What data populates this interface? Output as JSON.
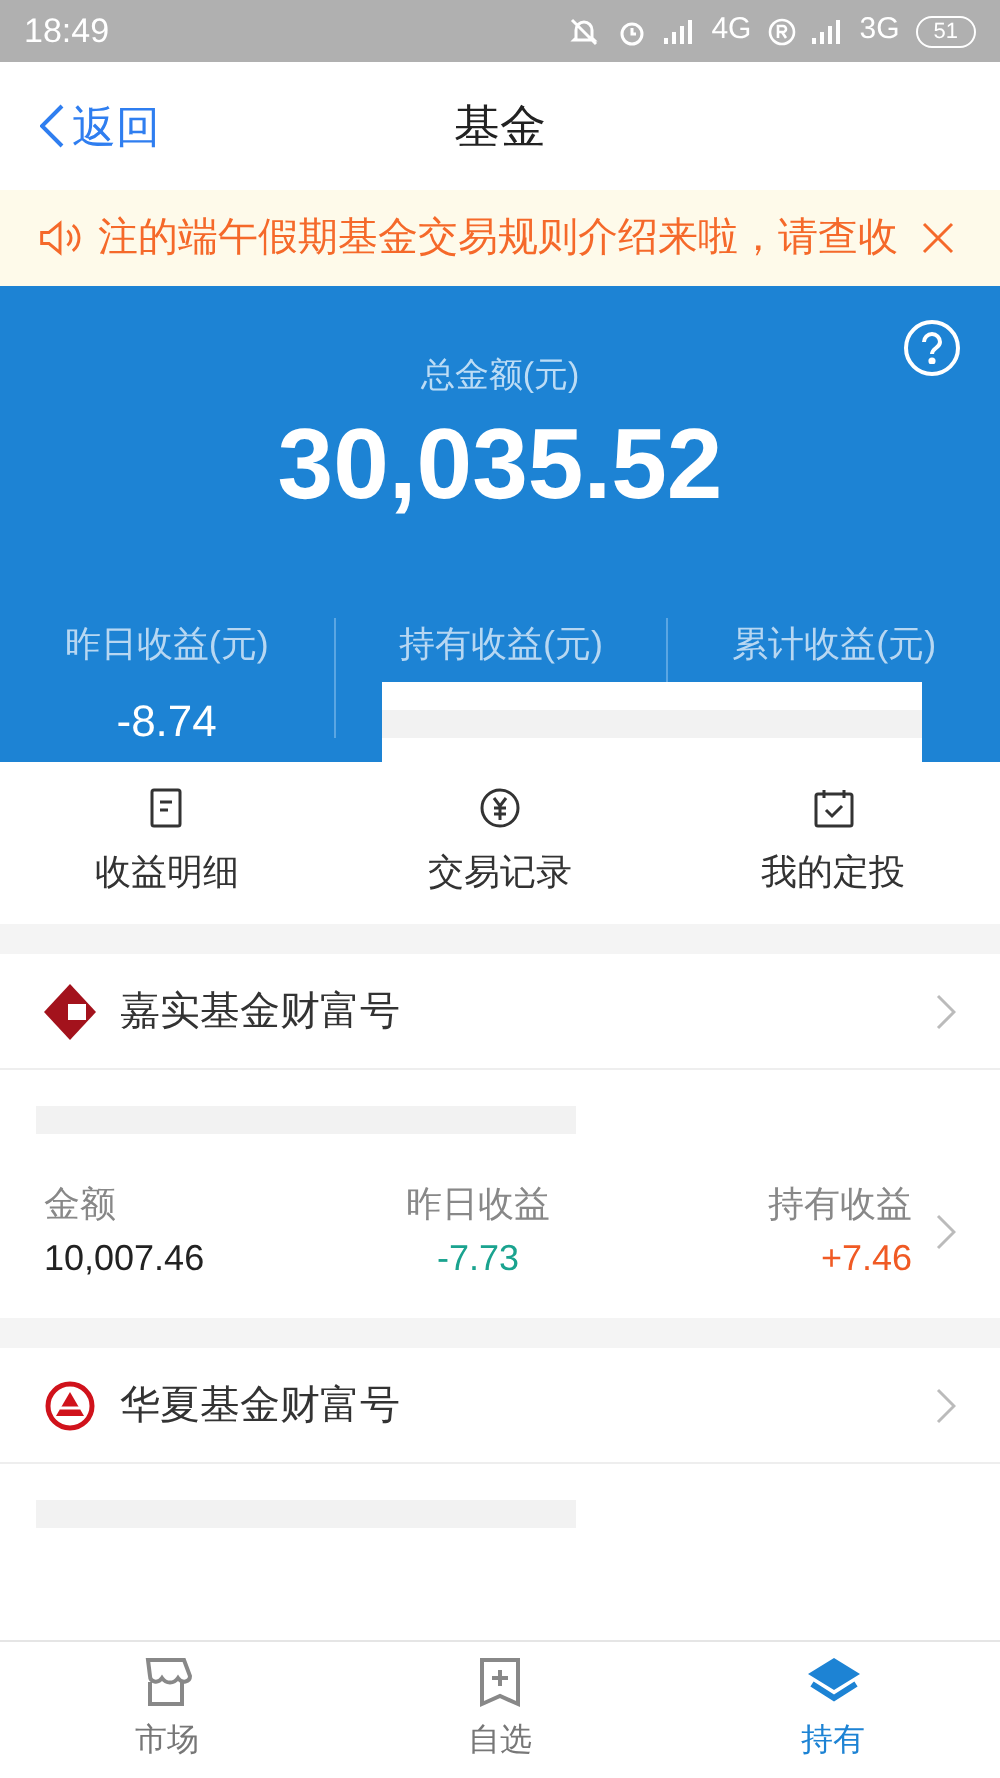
{
  "status_bar": {
    "time": "18:49",
    "network_1": "4G",
    "network_2": "3G",
    "battery": "51"
  },
  "nav": {
    "back": "返回",
    "title": "基金"
  },
  "notice": {
    "text": "注的端午假期基金交易规则介绍来啦，请查收"
  },
  "summary": {
    "total_label": "总金额(元)",
    "total": "30,035.52",
    "redacted": true,
    "stats": [
      {
        "label": "昨日收益(元)",
        "value": "-8.74"
      },
      {
        "label": "持有收益(元)"
      },
      {
        "label": "累计收益(元)"
      }
    ]
  },
  "shortcuts": [
    {
      "kind": "doc",
      "label": "收益明细"
    },
    {
      "kind": "yen",
      "label": "交易记录"
    },
    {
      "kind": "calendar",
      "label": "我的定投"
    }
  ],
  "funds": [
    {
      "kind": "diamond",
      "name": "嘉实基金财富号",
      "stats": [
        {
          "label": "金额",
          "value": "10,007.46",
          "color": "#222222"
        },
        {
          "label": "昨日收益",
          "value": "-7.73",
          "color": "#1aa38f"
        },
        {
          "label": "持有收益",
          "value": "+7.46",
          "color": "#f05a24"
        }
      ]
    },
    {
      "kind": "circle",
      "name": "华夏基金财富号"
    }
  ],
  "tabs": [
    {
      "kind": "store",
      "label": "市场",
      "selected": false
    },
    {
      "kind": "add",
      "label": "自选",
      "selected": false
    },
    {
      "kind": "hold",
      "label": "持有",
      "selected": true
    }
  ]
}
